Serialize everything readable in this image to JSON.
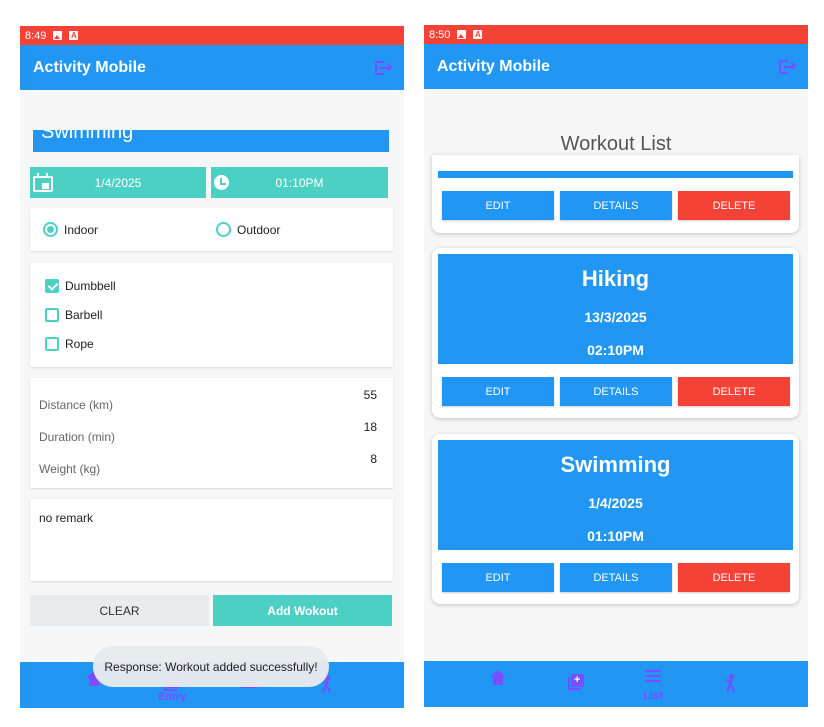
{
  "left": {
    "status_time": "8:49",
    "app_title": "Activity Mobile",
    "activity_name": "Swimming",
    "date": "1/4/2025",
    "time": "01:10PM",
    "radio_indoor": "Indoor",
    "radio_outdoor": "Outdoor",
    "selected_location": "Indoor",
    "equipment": [
      {
        "label": "Dumbbell",
        "checked": true
      },
      {
        "label": "Barbell",
        "checked": false
      },
      {
        "label": "Rope",
        "checked": false
      }
    ],
    "metrics": [
      {
        "label": "Distance (km)",
        "value": "55"
      },
      {
        "label": "Duration (min)",
        "value": "18"
      },
      {
        "label": "Weight (kg)",
        "value": "8"
      }
    ],
    "remark": "no remark",
    "clear_label": "CLEAR",
    "add_label": "Add Wokout",
    "toast": "Response: Workout added successfully!",
    "nav_active_label": "Entry"
  },
  "right": {
    "status_time": "8:50",
    "app_title": "Activity Mobile",
    "heading": "Workout List",
    "buttons": {
      "edit": "EDIT",
      "details": "DETAILS",
      "delete": "DELETE"
    },
    "workouts": [
      {
        "name": "Hiking",
        "date": "13/3/2025",
        "time": "02:10PM"
      },
      {
        "name": "Swimming",
        "date": "1/4/2025",
        "time": "01:10PM"
      }
    ],
    "nav_active_label": "List"
  },
  "icons": [
    "image-icon",
    "a-icon",
    "logout-icon",
    "calendar-icon",
    "clock-icon",
    "home-icon",
    "add-entry-icon",
    "list-icon",
    "walk-icon"
  ],
  "colors": {
    "appbar": "#2196f3",
    "statusbar": "#f44336",
    "accent": "#4dd0c4",
    "delete": "#f44336",
    "nav_icon": "#7c4dff"
  }
}
